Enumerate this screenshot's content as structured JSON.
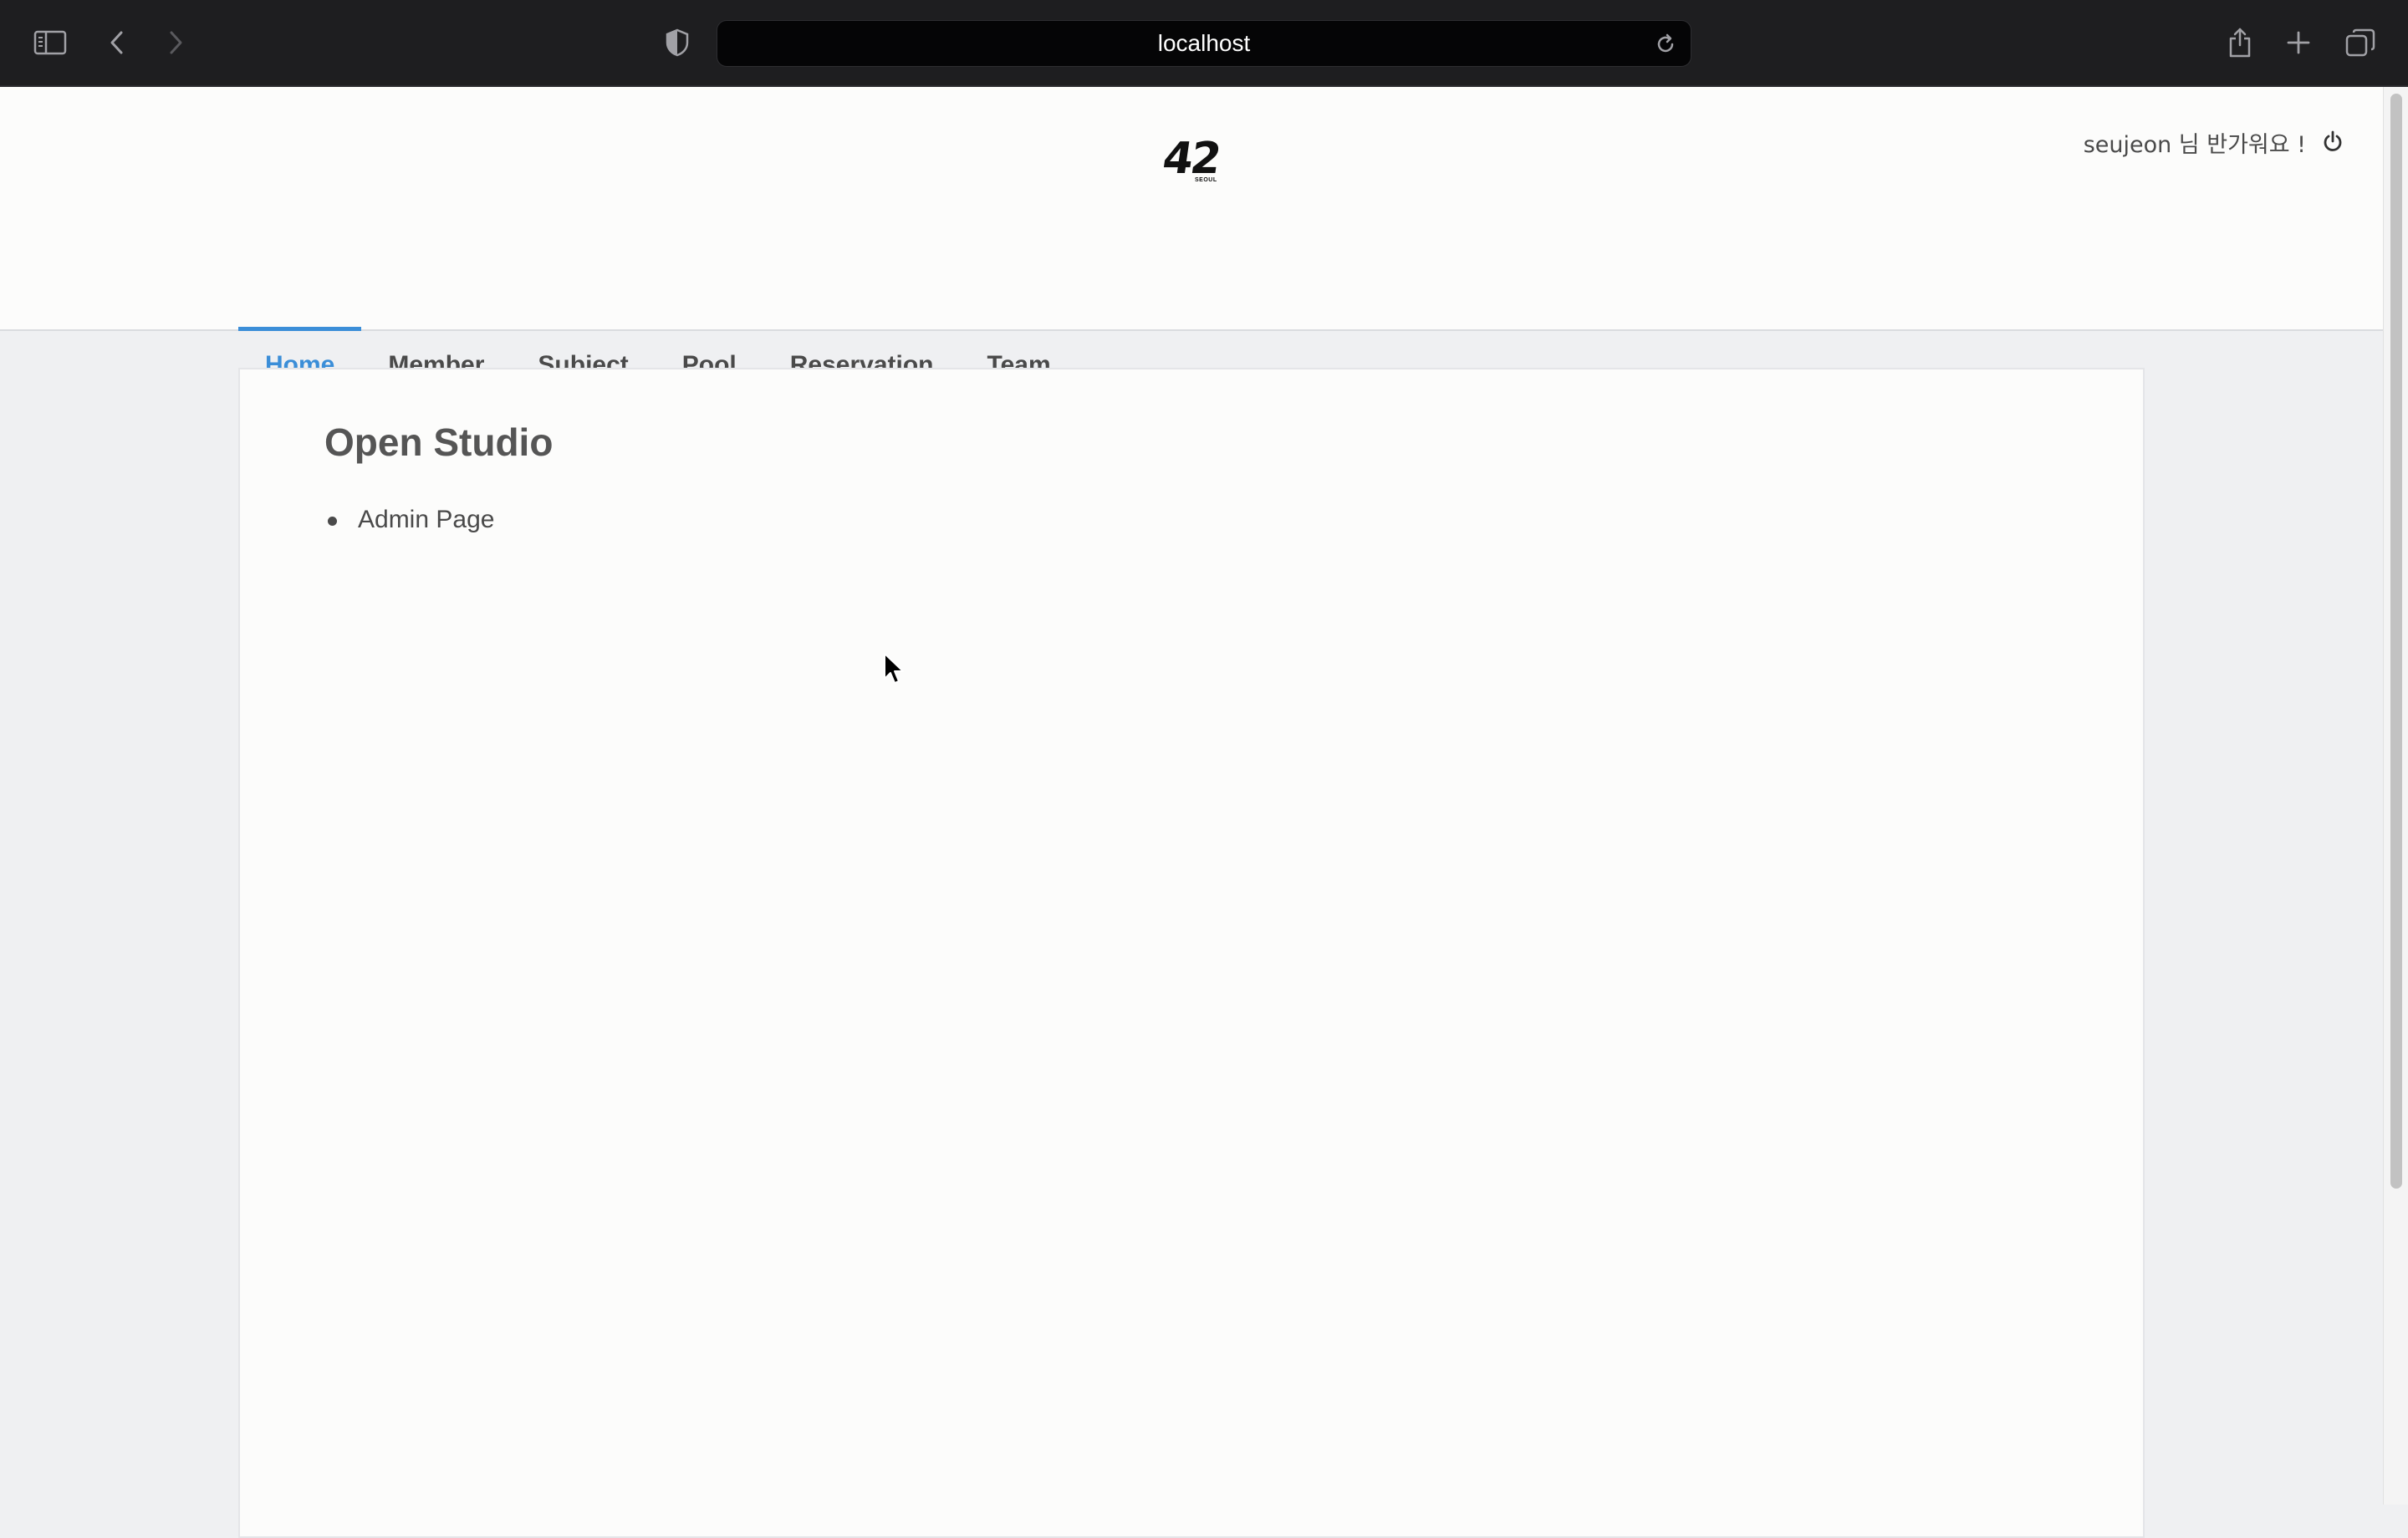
{
  "browser": {
    "url": "localhost",
    "icons": [
      "sidebar-icon",
      "back-icon",
      "forward-icon",
      "shield-icon",
      "reload-icon",
      "share-icon",
      "new-tab-icon",
      "tabs-overview-icon"
    ]
  },
  "header": {
    "logo_text": "42",
    "logo_subtext": "SEOUL",
    "user_greeting": "seujeon 님 반가워요 !"
  },
  "nav": {
    "items": [
      {
        "label": "Home",
        "active": true
      },
      {
        "label": "Member",
        "active": false
      },
      {
        "label": "Subject",
        "active": false
      },
      {
        "label": "Pool",
        "active": false
      },
      {
        "label": "Reservation",
        "active": false
      },
      {
        "label": "Team",
        "active": false
      }
    ]
  },
  "main": {
    "title": "Open Studio",
    "links": [
      "Admin Page"
    ]
  },
  "colors": {
    "accent": "#3b8ed8",
    "chrome_bg": "#1e1e20",
    "page_bg": "#eff0f2",
    "card_bg": "#fcfcfb"
  }
}
